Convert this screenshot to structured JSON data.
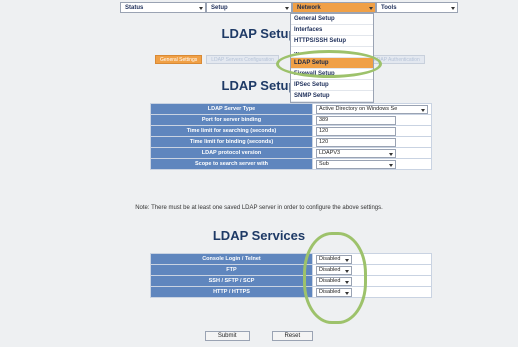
{
  "top_menu": [
    {
      "label": "Status"
    },
    {
      "label": "Setup"
    },
    {
      "label": "Network"
    },
    {
      "label": "Tools"
    }
  ],
  "network_dropdown": [
    "General Setup",
    "Interfaces",
    "HTTPS/SSH Setup",
    "...",
    "LDAP Setup",
    "Firewall Setup",
    "IPSec Setup",
    "SNMP Setup"
  ],
  "page_title": "LDAP Setup",
  "subtabs": [
    "General Settings",
    "LDAP Servers Configuration",
    "LDAP Authentication"
  ],
  "section1_title": "LDAP Setup",
  "settings": [
    {
      "label": "LDAP Server Type",
      "value": "Active Directory on Windows Se",
      "kind": "select"
    },
    {
      "label": "Port for server binding",
      "value": "389",
      "kind": "text"
    },
    {
      "label": "Time limit for searching (seconds)",
      "value": "120",
      "kind": "text"
    },
    {
      "label": "Time limit for binding (seconds)",
      "value": "120",
      "kind": "text"
    },
    {
      "label": "LDAP protocol version",
      "value": "LDAPV3",
      "kind": "select"
    },
    {
      "label": "Scope to search server with",
      "value": "Sub",
      "kind": "select"
    }
  ],
  "note": "Note: There must be at least one saved LDAP server in order to configure the above settings.",
  "section2_title": "LDAP Services",
  "services": [
    {
      "label": "Console Login / Telnet",
      "value": "Disabled"
    },
    {
      "label": "FTP",
      "value": "Disabled"
    },
    {
      "label": "SSH / SFTP / SCP",
      "value": "Disabled"
    },
    {
      "label": "HTTP / HTTPS",
      "value": "Disabled"
    }
  ],
  "buttons": {
    "submit": "Submit",
    "reset": "Reset"
  },
  "colors": {
    "accent": "#f0a046",
    "label_bg": "#5f86be",
    "highlight_circle": "#9dc26b"
  }
}
